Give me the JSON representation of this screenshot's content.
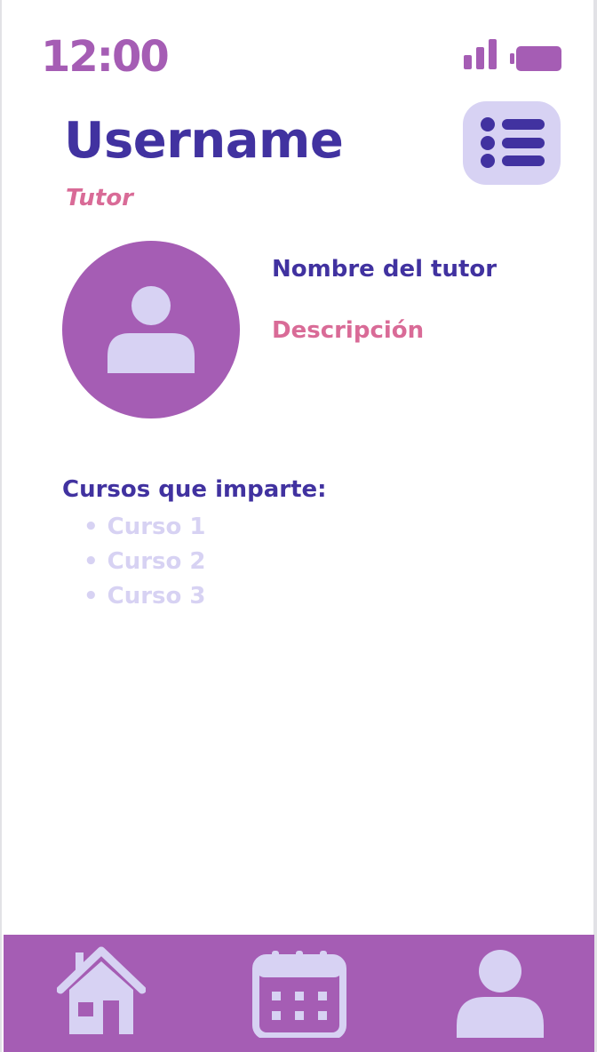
{
  "status_bar": {
    "time": "12:00",
    "signal_icon": "signal-bars-icon",
    "battery_icon": "battery-icon"
  },
  "header": {
    "title": "Username",
    "role": "Tutor",
    "menu_icon": "list-menu-icon"
  },
  "profile": {
    "avatar_icon": "user-avatar-icon",
    "name": "Nombre del tutor",
    "description": "Descripción"
  },
  "courses": {
    "heading": "Cursos que imparte:",
    "items": [
      "Curso 1",
      "Curso 2",
      "Curso 3"
    ]
  },
  "bottom_nav": {
    "items": [
      {
        "icon": "home-icon"
      },
      {
        "icon": "calendar-icon"
      },
      {
        "icon": "profile-icon"
      }
    ]
  },
  "colors": {
    "primary_dark": "#4132a0",
    "accent_purple": "#a55db4",
    "accent_pink": "#d96b97",
    "light_lavender": "#d7d2f3",
    "background": "#ffffff"
  }
}
